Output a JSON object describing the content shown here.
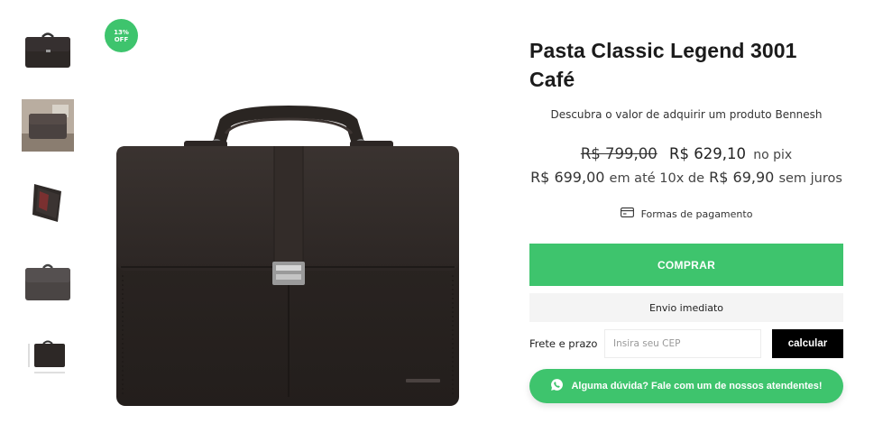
{
  "badge": {
    "line1": "13%",
    "line2": "OFF"
  },
  "product": {
    "title_line1": "Pasta Classic Legend 3001",
    "title_line2": "Café",
    "subtitle": "Descubra o valor de adquirir um produto Bennesh"
  },
  "pricing": {
    "old_price": "R$ 799,00",
    "pix_price": "R$ 629,10",
    "pix_label": "no pix",
    "full_price": "R$ 699,00",
    "installments_prefix": "em até 10x de",
    "installment_value": "R$ 69,90",
    "installments_suffix": "sem juros"
  },
  "payments": {
    "label": "Formas de pagamento",
    "icon": "credit-card-icon"
  },
  "actions": {
    "buy_label": "COMPRAR",
    "shipping_note": "Envio imediato",
    "help_label": "Alguma dúvida? Fale com um de nossos atendentes!",
    "help_icon": "whatsapp-icon"
  },
  "freight": {
    "label": "Frete e prazo",
    "cep_placeholder": "Insira seu CEP",
    "calc_label": "calcular"
  },
  "thumbnails": [
    {
      "name": "front-view"
    },
    {
      "name": "lifestyle-view"
    },
    {
      "name": "open-view"
    },
    {
      "name": "back-view"
    },
    {
      "name": "dimensions-view"
    }
  ],
  "colors": {
    "accent": "#3ec46d",
    "leather": "#2a2522",
    "button_dark": "#000000"
  }
}
